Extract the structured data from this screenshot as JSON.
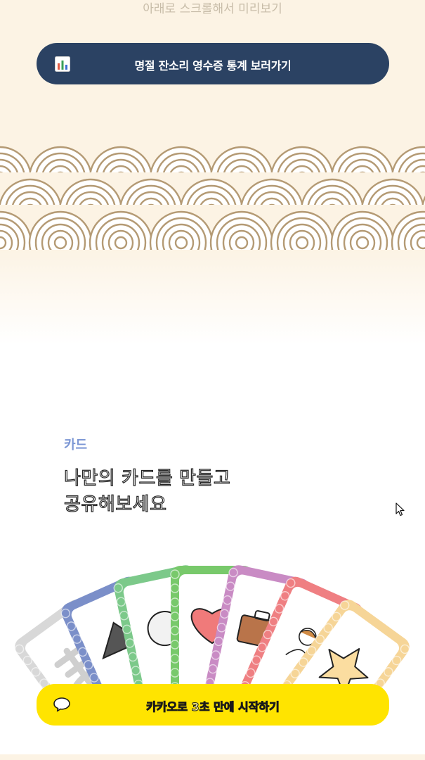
{
  "hero": {
    "scroll_hint": "아래로 스크롤해서 미리보기",
    "stats_button": {
      "label": "명절 잔소리 영수증 통계 보러가기",
      "icon": "bar-chart-icon"
    }
  },
  "section": {
    "eyebrow": "카드",
    "headline_line1": "나만의 카드를 만들고",
    "headline_line2": "공유해보세요"
  },
  "cards": [
    {
      "color": "#d8d8d8",
      "icon": "hanja-character-icon"
    },
    {
      "color": "#7b8fc9",
      "icon": "pointed-hat-icon"
    },
    {
      "color": "#7cc98a",
      "icon": "round-object-icon"
    },
    {
      "color": "#78c96b",
      "icon": "heart-icon"
    },
    {
      "color": "#c98bc4",
      "icon": "briefcase-icon"
    },
    {
      "color": "#ef7f82",
      "icon": "person-icon"
    },
    {
      "color": "#f6d597",
      "icon": "star-icon"
    }
  ],
  "cta": {
    "label": "카카오로 3초 만에 시작하기",
    "icon": "speech-bubble-icon"
  },
  "colors": {
    "navy": "#2b4263",
    "cream": "#fcf3e4",
    "kakao_yellow": "#ffe400",
    "wave_stroke": "#b49a74",
    "accent_blue": "#7b96d4"
  }
}
